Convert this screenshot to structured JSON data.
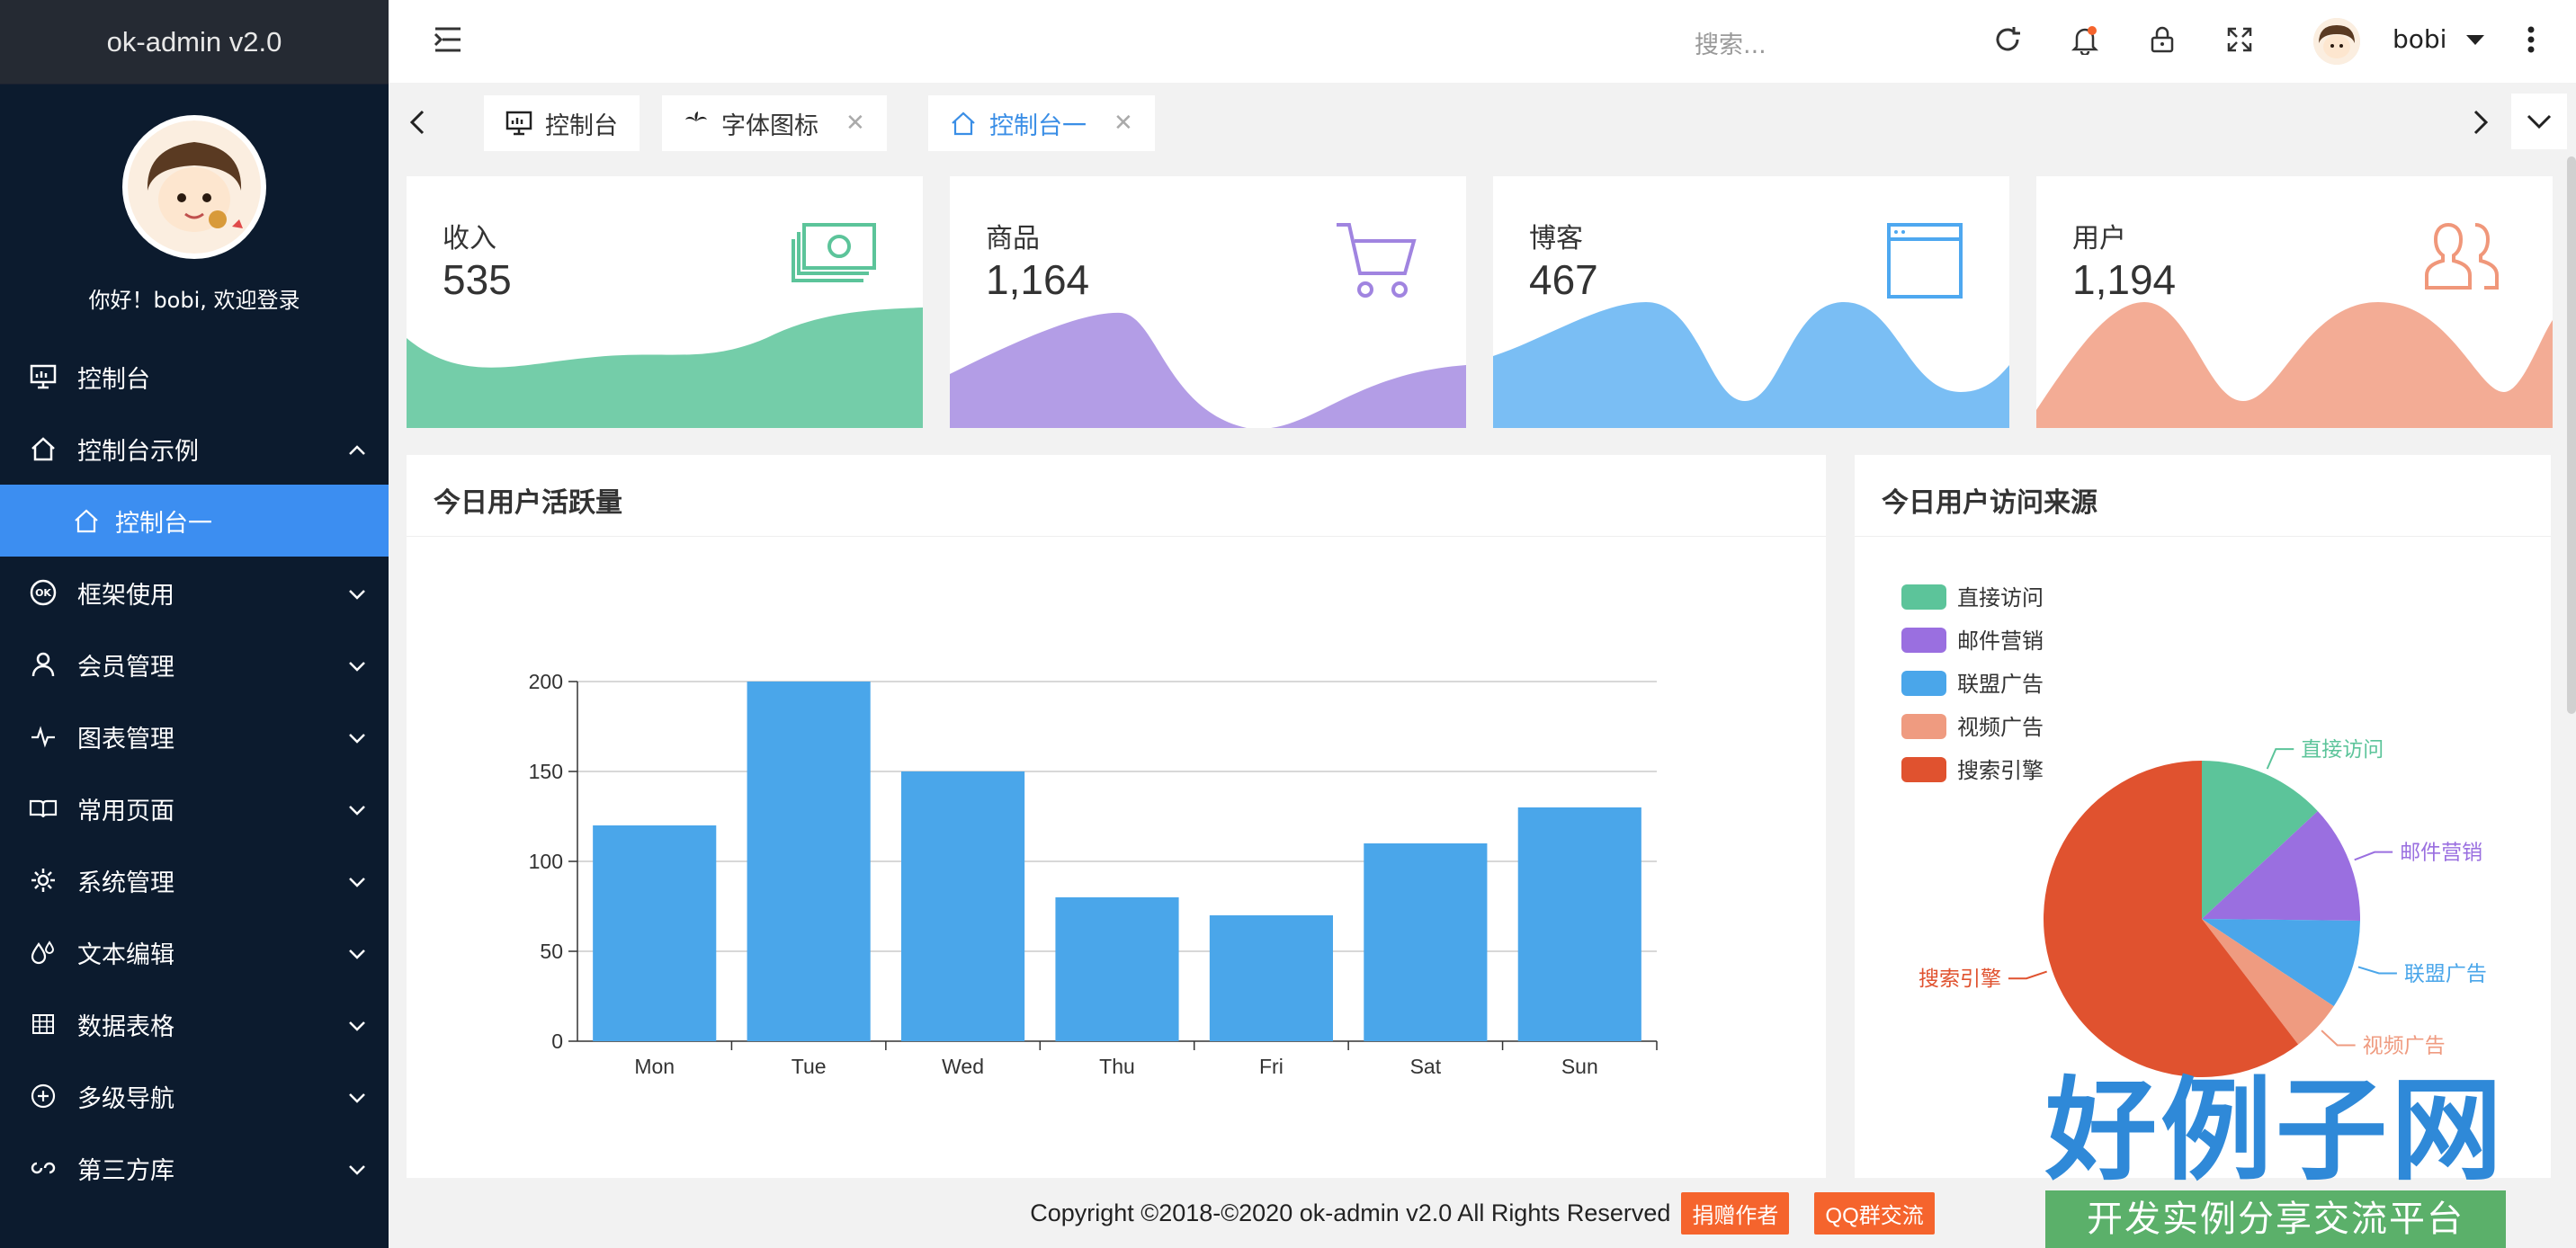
{
  "app": {
    "title": "ok-admin v2.0"
  },
  "sidebar": {
    "welcome": "你好！bobi, 欢迎登录",
    "items": [
      {
        "label": "控制台",
        "icon": "dashboard-icon"
      },
      {
        "label": "控制台示例",
        "icon": "home-icon",
        "expanded": true
      },
      {
        "label": "控制台一",
        "icon": "home-outline-icon",
        "sub": true,
        "active": true
      },
      {
        "label": "框架使用",
        "icon": "ok-logo-icon"
      },
      {
        "label": "会员管理",
        "icon": "user-icon"
      },
      {
        "label": "图表管理",
        "icon": "pulse-icon"
      },
      {
        "label": "常用页面",
        "icon": "book-icon"
      },
      {
        "label": "系统管理",
        "icon": "gear-icon"
      },
      {
        "label": "文本编辑",
        "icon": "drops-icon"
      },
      {
        "label": "数据表格",
        "icon": "table-icon"
      },
      {
        "label": "多级导航",
        "icon": "plus-circle-icon"
      },
      {
        "label": "第三方库",
        "icon": "link-icon"
      }
    ]
  },
  "header": {
    "search_placeholder": "搜索...",
    "user_name": "bobi"
  },
  "tabs": [
    {
      "label": "控制台",
      "icon": "monitor-icon",
      "closable": false
    },
    {
      "label": "字体图标",
      "icon": "palm-icon",
      "closable": true
    },
    {
      "label": "控制台一",
      "icon": "home-outline-icon",
      "closable": true,
      "active": true
    }
  ],
  "stats": [
    {
      "label": "收入",
      "value": "535",
      "color": "#5cc49a",
      "icon": "money-icon"
    },
    {
      "label": "商品",
      "value": "1,164",
      "color": "#a084e0",
      "icon": "cart-icon"
    },
    {
      "label": "博客",
      "value": "467",
      "color": "#4ea8f0",
      "icon": "browser-window-icon"
    },
    {
      "label": "用户",
      "value": "1,194",
      "color": "#f0977a",
      "icon": "users-icon"
    }
  ],
  "activity_panel": {
    "title": "今日用户活跃量"
  },
  "source_panel": {
    "title": "今日用户访问来源"
  },
  "chart_data": [
    {
      "type": "bar",
      "title": "今日用户活跃量",
      "categories": [
        "Mon",
        "Tue",
        "Wed",
        "Thu",
        "Fri",
        "Sat",
        "Sun"
      ],
      "values": [
        120,
        200,
        150,
        80,
        70,
        110,
        130
      ],
      "ylim": [
        0,
        200
      ],
      "yticks": [
        0,
        50,
        100,
        150,
        200
      ],
      "color": "#4aa6ea",
      "grid": true
    },
    {
      "type": "pie",
      "title": "今日用户访问来源",
      "legend_position": "top-left",
      "slices": [
        {
          "name": "直接访问",
          "value": 335,
          "color": "#5cc49a"
        },
        {
          "name": "邮件营销",
          "value": 310,
          "color": "#9a6fe0"
        },
        {
          "name": "联盟广告",
          "value": 234,
          "color": "#4aa6ea"
        },
        {
          "name": "视频广告",
          "value": 135,
          "color": "#ef9b80"
        },
        {
          "name": "搜索引擎",
          "value": 1548,
          "color": "#e0522f"
        }
      ]
    }
  ],
  "footer": {
    "copyright": "Copyright ©2018-©2020 ok-admin v2.0 All Rights Reserved",
    "donate": "捐赠作者",
    "qq": "QQ群交流"
  },
  "watermark": {
    "big": "好例子网",
    "small": "开发实例分享交流平台"
  }
}
